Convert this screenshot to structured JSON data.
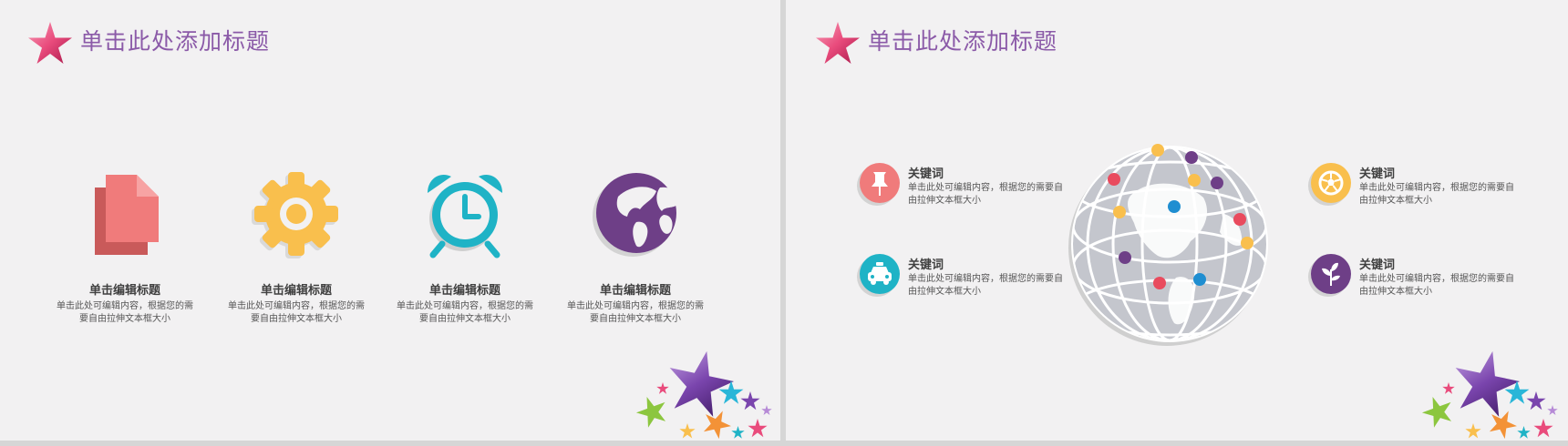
{
  "left_slide": {
    "title": "单击此处添加标题",
    "features": [
      {
        "icon": "document-icon",
        "title": "单击编辑标题",
        "desc": "单击此处可编辑内容，根据您的需要自由拉伸文本框大小",
        "color": "#f07b7b"
      },
      {
        "icon": "gear-icon",
        "title": "单击编辑标题",
        "desc": "单击此处可编辑内容，根据您的需要自由拉伸文本框大小",
        "color": "#f9bf4d"
      },
      {
        "icon": "alarm-clock-icon",
        "title": "单击编辑标题",
        "desc": "单击此处可编辑内容，根据您的需要自由拉伸文本框大小",
        "color": "#1fb3c6"
      },
      {
        "icon": "globe-icon",
        "title": "单击编辑标题",
        "desc": "单击此处可编辑内容，根据您的需要自由拉伸文本框大小",
        "color": "#6e3f87"
      }
    ]
  },
  "right_slide": {
    "title": "单击此处添加标题",
    "keywords": [
      {
        "icon": "pushpin-icon",
        "title": "关键词",
        "desc": "单击此处可编辑内容，根据您的需要自由拉伸文本框大小",
        "color": "#f07b7b"
      },
      {
        "icon": "taxi-icon",
        "title": "关键词",
        "desc": "单击此处可编辑内容，根据您的需要自由拉伸文本框大小",
        "color": "#1fb3c6"
      },
      {
        "icon": "soccer-ball-icon",
        "title": "关键词",
        "desc": "单击此处可编辑内容，根据您的需要自由拉伸文本框大小",
        "color": "#f9bf4d"
      },
      {
        "icon": "plant-icon",
        "title": "关键词",
        "desc": "单击此处可编辑内容，根据您的需要自由拉伸文本框大小",
        "color": "#6e3f87"
      }
    ]
  },
  "colors": {
    "title": "#8b5aa8",
    "pink": "#f07b7b",
    "yellow": "#f9bf4d",
    "cyan": "#1fb3c6",
    "purple": "#6e3f87",
    "globe_grey": "#c4c6cd"
  }
}
